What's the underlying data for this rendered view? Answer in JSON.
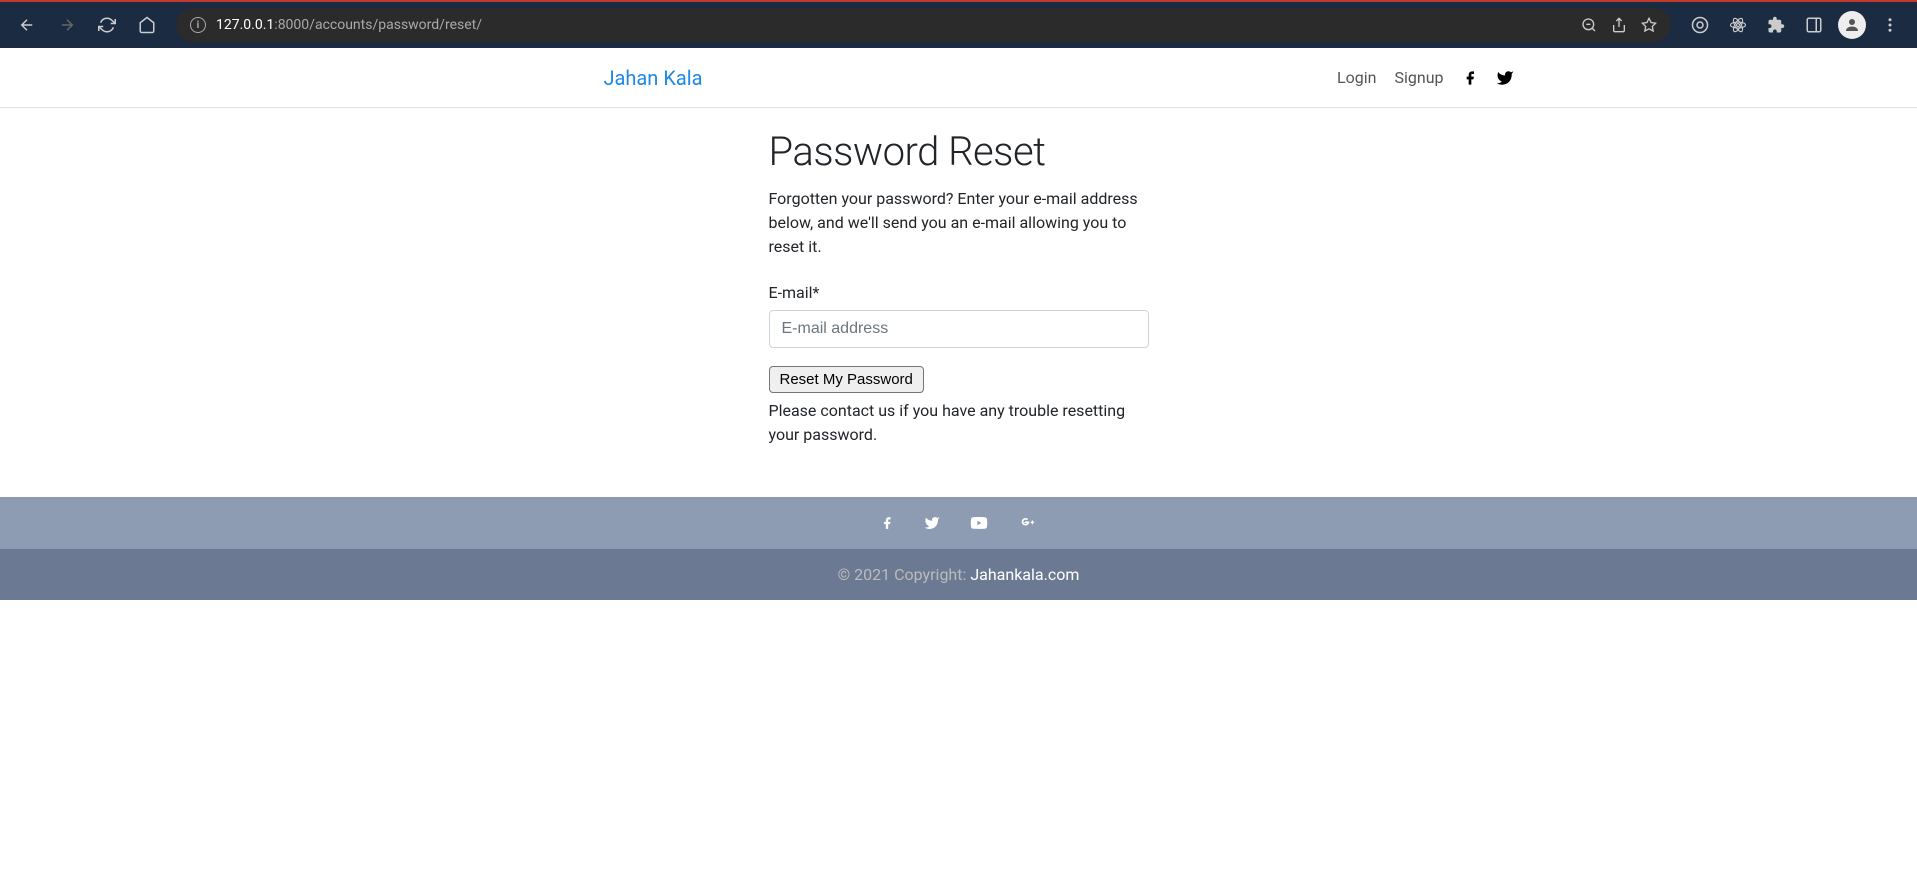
{
  "browser": {
    "url_host": "127.0.0.1",
    "url_port": ":8000",
    "url_path": "/accounts/password/reset/"
  },
  "navbar": {
    "brand": "Jahan Kala",
    "login_label": "Login",
    "signup_label": "Signup"
  },
  "main": {
    "title": "Password Reset",
    "description": "Forgotten your password? Enter your e-mail address below, and we'll send you an e-mail allowing you to reset it.",
    "email_label": "E-mail*",
    "email_placeholder": "E-mail address",
    "submit_label": "Reset My Password",
    "help_text": "Please contact us if you have any trouble resetting your password."
  },
  "footer": {
    "copyright_prefix": "© 2021 Copyright: ",
    "copyright_link": "Jahankala.com"
  }
}
